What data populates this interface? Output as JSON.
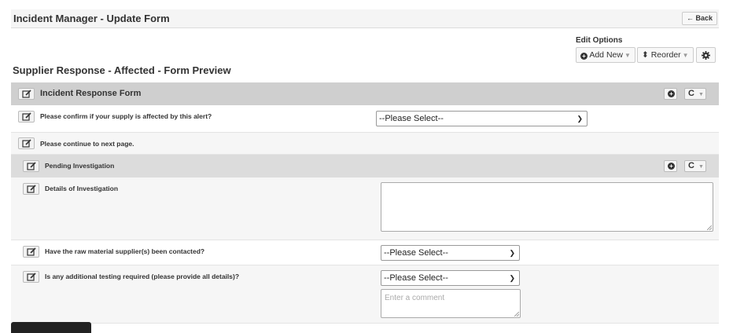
{
  "header": {
    "title": "Incident Manager - Update Form",
    "back_label": "← Back"
  },
  "edit_options": {
    "label": "Edit Options",
    "add_new_label": "Add New",
    "reorder_label": "⬍ Reorder"
  },
  "form": {
    "title": "Supplier Response - Affected - Form Preview",
    "section_title": "Incident Response Form",
    "questions": [
      {
        "label": "Please confirm if your supply is affected by this alert?",
        "value": "--Please Select--"
      },
      {
        "label": "Please continue to next page."
      }
    ],
    "subsection": {
      "title": "Pending Investigation",
      "items": [
        {
          "label": "Details of Investigation",
          "value": ""
        },
        {
          "label": "Have the raw material supplier(s) been contacted?",
          "value": "--Please Select--"
        },
        {
          "label": "Is any additional testing required (please provide all details)?",
          "value": "--Please Select--",
          "comment_placeholder": "Enter a comment"
        }
      ]
    }
  },
  "icons": {
    "edit": "edit-icon",
    "add": "add-circle-icon",
    "refresh": "refresh-icon",
    "settings": "gear-icon"
  }
}
